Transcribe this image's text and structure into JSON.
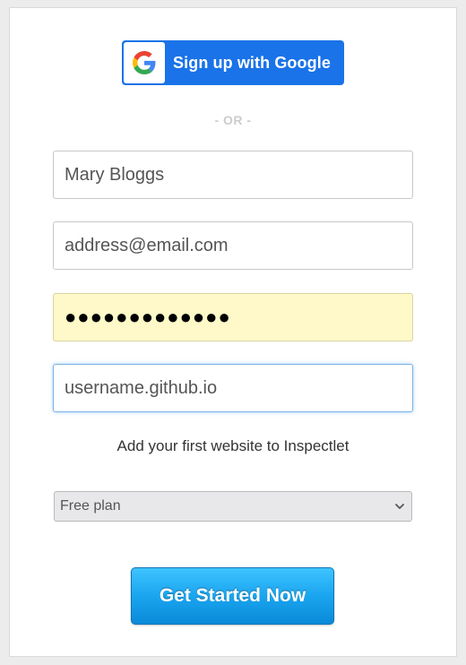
{
  "google_signup": {
    "label": "Sign up with Google",
    "icon": "google-logo-icon",
    "color": "#1a73e8"
  },
  "divider": {
    "text": "- OR -"
  },
  "form": {
    "name_value": "Mary Bloggs",
    "email_value": "address@email.com",
    "password_value": "●●●●●●●●●●●●●",
    "website_value": "username.github.io",
    "helper_text": "Add your first website to Inspectlet",
    "plan": {
      "selected": "Free plan",
      "icon": "chevron-down-icon"
    },
    "submit_label": "Get Started Now",
    "submit_color": "#1aa5ef"
  }
}
